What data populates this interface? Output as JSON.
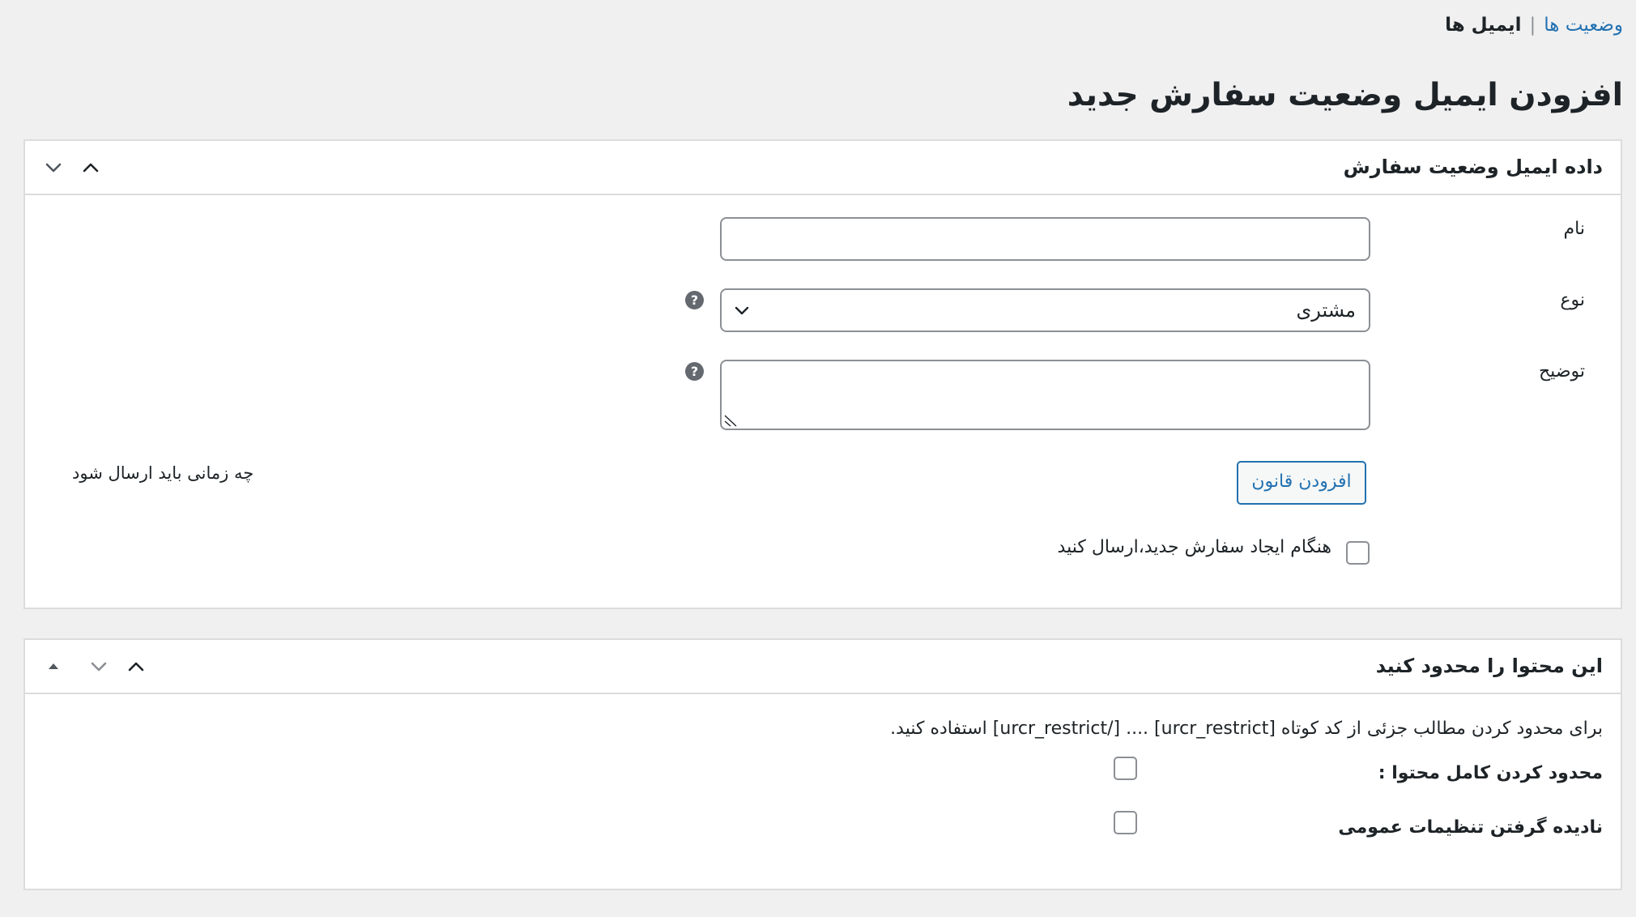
{
  "breadcrumb": {
    "link_label": "وضعیت ها",
    "separator": "|",
    "current_label": "ایمیل ها"
  },
  "page_title": "افزودن ایمیل وضعیت سفارش جدید",
  "box_order_email": {
    "title": "داده ایمیل وضعیت سفارش",
    "name_label": "نام",
    "name_value": "",
    "type_label": "نوع",
    "type_selected": "مشتری",
    "description_label": "توضیح",
    "description_value": "",
    "help_glyph": "?",
    "add_rule_label": "افزودن قانون",
    "when_to_send_label": "چه زمانی باید ارسال شود",
    "send_on_new_order_label": "هنگام ایجاد سفارش جدید،ارسال کنید",
    "send_on_new_order_checked": false
  },
  "box_restrict": {
    "title": "این محتوا را محدود کنید",
    "description": "برای محدود کردن مطالب جزئی از کد کوتاه [urcr_restrict] .... [/urcr_restrict] استفاده کنید.",
    "restrict_full_label": "محدود کردن کامل محتوا :",
    "restrict_full_checked": false,
    "ignore_global_label": "نادیده گرفتن تنظیمات عمومی",
    "ignore_global_checked": false
  },
  "icons": {
    "collapse_up": "chevron-up-icon",
    "collapse_down": "chevron-down-icon",
    "move_up": "triangle-up-icon",
    "select_arrow": "chevron-down-icon",
    "help": "question-circle-icon"
  },
  "colors": {
    "background": "#f0f0f1",
    "link": "#2271b1",
    "border": "#dcdcde",
    "input_border": "#8c8f94",
    "text": "#1d2327"
  }
}
